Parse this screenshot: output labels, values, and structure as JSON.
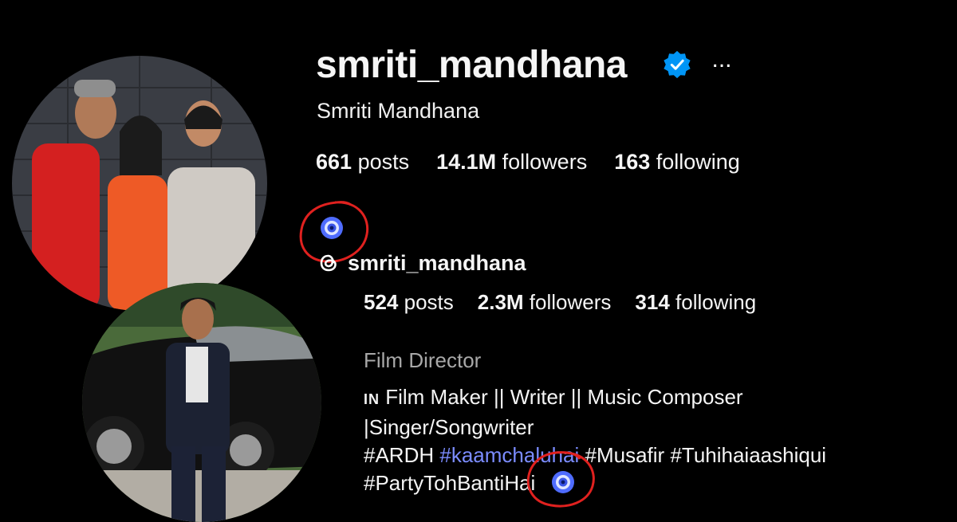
{
  "profile": {
    "username": "smriti_mandhana",
    "full_name": "Smriti Mandhana",
    "more_icon": "...",
    "stats": [
      {
        "count": "661",
        "label": " posts"
      },
      {
        "count": "14.1M",
        "label": " followers"
      },
      {
        "count": "163",
        "label": " following"
      }
    ]
  },
  "threads": {
    "handle": "smriti_mandhana",
    "stats": [
      {
        "count": "524",
        "label": " posts"
      },
      {
        "count": "2.3M",
        "label": " followers"
      },
      {
        "count": "314",
        "label": " following"
      }
    ]
  },
  "bio": {
    "category": "Film Director",
    "country_code": "IN",
    "line1": " Film Maker || Writer || Music Composer",
    "line2": "|Singer/Songwriter",
    "tags": [
      "#ARDH",
      "#kaamchaluhai",
      "#Musafir",
      "#Tuhihaiaashiqui"
    ],
    "tag_last": "#PartyTohBantiHai"
  },
  "colors": {
    "verified": "#0095f6",
    "eye_badge": "#4f6cff",
    "highlight_circle": "#e0211f",
    "link": "#7b8cff"
  },
  "icons": {
    "verified": "verified-badge-icon",
    "threads": "threads-icon",
    "eye": "eye-icon"
  }
}
